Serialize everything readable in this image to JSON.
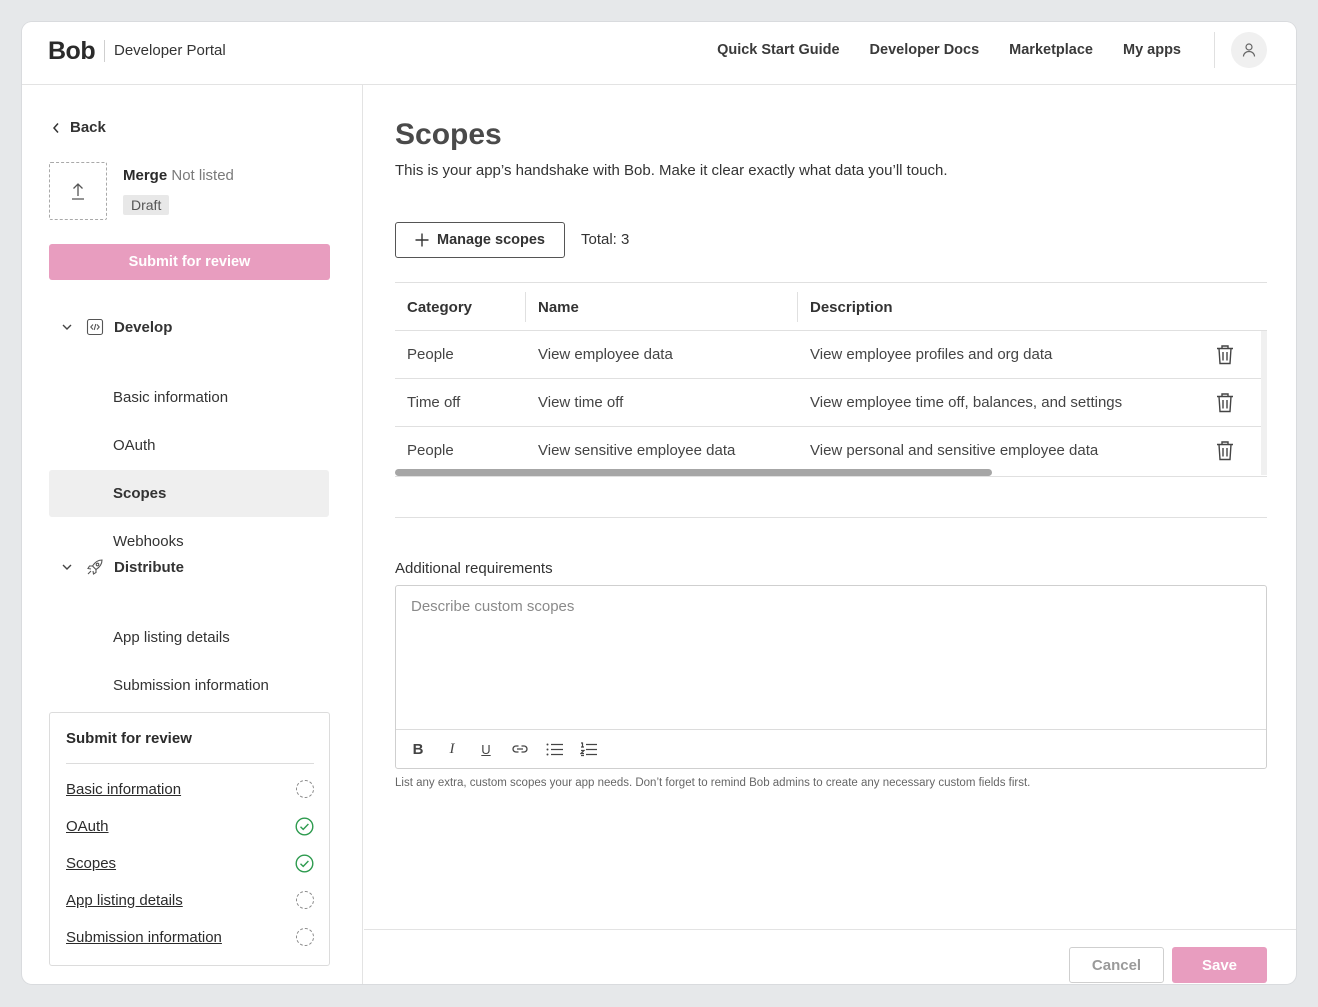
{
  "header": {
    "logo": "Bob",
    "portal": "Developer Portal",
    "nav": [
      "Quick Start Guide",
      "Developer Docs",
      "Marketplace",
      "My apps"
    ],
    "avatar_icon": "user-icon"
  },
  "sidebar": {
    "back_label": "Back",
    "app": {
      "name": "Merge",
      "listing_status": "Not listed",
      "status_badge": "Draft",
      "upload_icon": "upload-icon"
    },
    "submit_label": "Submit for review",
    "groups": [
      {
        "label": "Develop",
        "icon": "code-icon",
        "items": [
          "Basic information",
          "OAuth",
          "Scopes",
          "Webhooks"
        ]
      },
      {
        "label": "Distribute",
        "icon": "rocket-icon",
        "items": [
          "App listing details",
          "Submission information"
        ]
      }
    ],
    "active_item": "Scopes",
    "review": {
      "title": "Submit for review",
      "items": [
        {
          "label": "Basic information",
          "status": "incomplete"
        },
        {
          "label": "OAuth",
          "status": "complete"
        },
        {
          "label": "Scopes",
          "status": "complete"
        },
        {
          "label": "App listing details",
          "status": "incomplete"
        },
        {
          "label": "Submission information",
          "status": "incomplete"
        }
      ]
    }
  },
  "main": {
    "title": "Scopes",
    "subtitle": "This is your app’s handshake with Bob. Make it clear exactly what data you’ll touch.",
    "manage_label": "Manage scopes",
    "total": "Total: 3",
    "table": {
      "columns": [
        "Category",
        "Name",
        "Description"
      ],
      "rows": [
        {
          "category": "People",
          "name": "View employee data",
          "description": "View employee profiles and org data"
        },
        {
          "category": "Time off",
          "name": "View time off",
          "description": "View employee time off, balances, and settings"
        },
        {
          "category": "People",
          "name": "View sensitive employee data",
          "description": "View personal and sensitive employee data"
        }
      ]
    },
    "requirements": {
      "label": "Additional requirements",
      "placeholder": "Describe custom scopes",
      "value": "",
      "toolbar": [
        {
          "name": "bold-icon",
          "glyph": "B"
        },
        {
          "name": "italic-icon",
          "glyph": "I"
        },
        {
          "name": "underline-icon",
          "glyph": "U"
        },
        {
          "name": "link-icon",
          "glyph": ""
        },
        {
          "name": "bullet-list-icon",
          "glyph": ""
        },
        {
          "name": "numbered-list-icon",
          "glyph": ""
        }
      ],
      "hint": "List any extra, custom scopes your app needs. Don’t forget to remind Bob admins to create any necessary custom fields first."
    },
    "footer": {
      "cancel_label": "Cancel",
      "save_label": "Save"
    }
  },
  "colors": {
    "accent_pink": "#e89dbf",
    "check_green": "#2e9b4f"
  }
}
